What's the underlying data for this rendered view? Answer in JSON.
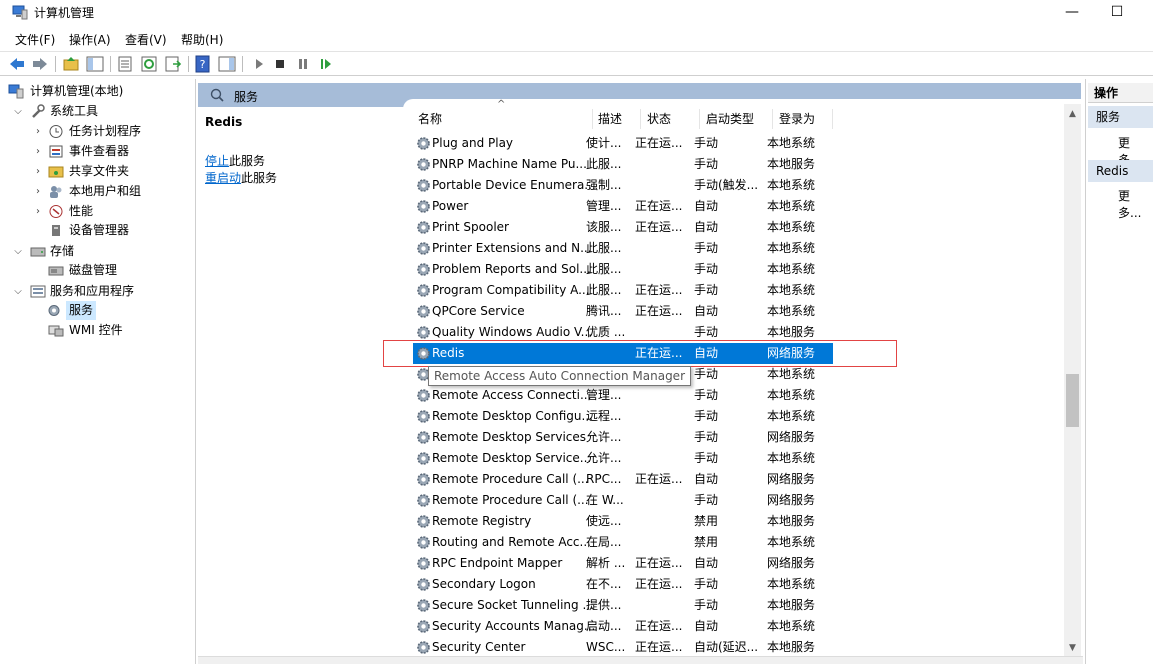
{
  "window": {
    "title": "计算机管理",
    "minimize": "—",
    "maximize": "☐"
  },
  "menu": [
    {
      "label": "文件(F)"
    },
    {
      "label": "操作(A)"
    },
    {
      "label": "查看(V)"
    },
    {
      "label": "帮助(H)"
    }
  ],
  "tree": {
    "items": [
      {
        "label": "计算机管理(本地)",
        "icon": "computer-management-icon"
      },
      {
        "label": "系统工具",
        "icon": "tools-icon"
      },
      {
        "label": "任务计划程序",
        "icon": "clock-icon"
      },
      {
        "label": "事件查看器",
        "icon": "event-viewer-icon"
      },
      {
        "label": "共享文件夹",
        "icon": "shared-folder-icon"
      },
      {
        "label": "本地用户和组",
        "icon": "users-icon"
      },
      {
        "label": "性能",
        "icon": "performance-icon"
      },
      {
        "label": "设备管理器",
        "icon": "device-manager-icon"
      },
      {
        "label": "存储",
        "icon": "storage-icon"
      },
      {
        "label": "磁盘管理",
        "icon": "disk-icon"
      },
      {
        "label": "服务和应用程序",
        "icon": "services-apps-icon"
      },
      {
        "label": "服务",
        "icon": "services-icon"
      },
      {
        "label": "WMI 控件",
        "icon": "wmi-icon"
      }
    ]
  },
  "center": {
    "header_title": "服务",
    "selected_service": "Redis",
    "stop_link": "停止",
    "stop_suffix": "此服务",
    "restart_link": "重启动",
    "restart_suffix": "此服务"
  },
  "columns": {
    "name": "名称",
    "desc": "描述",
    "status": "状态",
    "startup": "启动类型",
    "logon": "登录为",
    "sort_indicator": "^"
  },
  "services": [
    {
      "name": "Plug and Play",
      "desc": "使计...",
      "status": "正在运...",
      "startup": "手动",
      "logon": "本地系统"
    },
    {
      "name": "PNRP Machine Name Pu...",
      "desc": "此服...",
      "status": "",
      "startup": "手动",
      "logon": "本地服务"
    },
    {
      "name": "Portable Device Enumera...",
      "desc": "强制...",
      "status": "",
      "startup": "手动(触发...",
      "logon": "本地系统"
    },
    {
      "name": "Power",
      "desc": "管理...",
      "status": "正在运...",
      "startup": "自动",
      "logon": "本地系统"
    },
    {
      "name": "Print Spooler",
      "desc": "该服...",
      "status": "正在运...",
      "startup": "自动",
      "logon": "本地系统"
    },
    {
      "name": "Printer Extensions and N...",
      "desc": "此服...",
      "status": "",
      "startup": "手动",
      "logon": "本地系统"
    },
    {
      "name": "Problem Reports and Sol...",
      "desc": "此服...",
      "status": "",
      "startup": "手动",
      "logon": "本地系统"
    },
    {
      "name": "Program Compatibility A...",
      "desc": "此服...",
      "status": "正在运...",
      "startup": "手动",
      "logon": "本地系统"
    },
    {
      "name": "QPCore Service",
      "desc": "腾讯...",
      "status": "正在运...",
      "startup": "自动",
      "logon": "本地系统"
    },
    {
      "name": "Quality Windows Audio V...",
      "desc": "优质 ...",
      "status": "",
      "startup": "手动",
      "logon": "本地服务"
    },
    {
      "name": "Redis",
      "desc": "",
      "status": "正在运...",
      "startup": "自动",
      "logon": "网络服务"
    },
    {
      "name": "",
      "desc": "",
      "status": "",
      "startup": "手动",
      "logon": "本地系统"
    },
    {
      "name": "Remote Access Connecti...",
      "desc": "管理...",
      "status": "",
      "startup": "手动",
      "logon": "本地系统"
    },
    {
      "name": "Remote Desktop Configu...",
      "desc": "远程...",
      "status": "",
      "startup": "手动",
      "logon": "本地系统"
    },
    {
      "name": "Remote Desktop Services",
      "desc": "允许...",
      "status": "",
      "startup": "手动",
      "logon": "网络服务"
    },
    {
      "name": "Remote Desktop Service...",
      "desc": "允许...",
      "status": "",
      "startup": "手动",
      "logon": "本地系统"
    },
    {
      "name": "Remote Procedure Call (...",
      "desc": "RPC...",
      "status": "正在运...",
      "startup": "自动",
      "logon": "网络服务"
    },
    {
      "name": "Remote Procedure Call (...",
      "desc": "在 W...",
      "status": "",
      "startup": "手动",
      "logon": "网络服务"
    },
    {
      "name": "Remote Registry",
      "desc": "使远...",
      "status": "",
      "startup": "禁用",
      "logon": "本地服务"
    },
    {
      "name": "Routing and Remote Acc...",
      "desc": "在局...",
      "status": "",
      "startup": "禁用",
      "logon": "本地系统"
    },
    {
      "name": "RPC Endpoint Mapper",
      "desc": "解析 ...",
      "status": "正在运...",
      "startup": "自动",
      "logon": "网络服务"
    },
    {
      "name": "Secondary Logon",
      "desc": "在不...",
      "status": "正在运...",
      "startup": "手动",
      "logon": "本地系统"
    },
    {
      "name": "Secure Socket Tunneling ...",
      "desc": "提供...",
      "status": "",
      "startup": "手动",
      "logon": "本地服务"
    },
    {
      "name": "Security Accounts Manag...",
      "desc": "启动...",
      "status": "正在运...",
      "startup": "自动",
      "logon": "本地系统"
    },
    {
      "name": "Security Center",
      "desc": "WSC...",
      "status": "正在运...",
      "startup": "自动(延迟...",
      "logon": "本地服务"
    }
  ],
  "tooltip": "Remote Access Auto Connection Manager",
  "actions": {
    "header": "操作",
    "groups": [
      {
        "label": "服务",
        "more": "更多..."
      },
      {
        "label": "Redis",
        "more": "更多..."
      }
    ]
  },
  "colors": {
    "selection": "#0078d7",
    "header_band": "#a6bcd8",
    "highlight_border": "#e24444",
    "link": "#0066cc"
  }
}
